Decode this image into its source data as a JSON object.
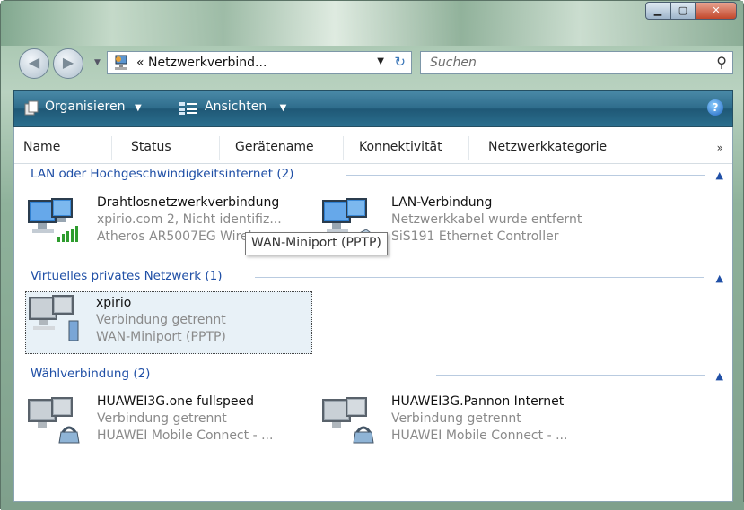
{
  "address": {
    "path": "« Netzwerkverbind..."
  },
  "search": {
    "placeholder": "Suchen"
  },
  "toolbar": {
    "organize_label": "Organisieren",
    "views_label": "Ansichten"
  },
  "columns": [
    "Name",
    "Status",
    "Gerätename",
    "Konnektivität",
    "Netzwerkkategorie"
  ],
  "groups": [
    {
      "title": "LAN oder Hochgeschwindigkeitsinternet (2)",
      "items": [
        {
          "name": "Drahtlosnetzwerkverbindung",
          "status": "xpirio.com  2, Nicht identifiz...",
          "device": "Atheros AR5007EG Wireless ...",
          "icon": "wireless-network-icon"
        },
        {
          "name": "LAN-Verbindung",
          "status": "Netzwerkkabel wurde entfernt",
          "device": "SiS191 Ethernet Controller",
          "icon": "lan-disconnected-icon"
        }
      ]
    },
    {
      "title": "Virtuelles privates Netzwerk (1)",
      "items": [
        {
          "name": "xpirio",
          "status": "Verbindung getrennt",
          "device": "WAN-Miniport (PPTP)",
          "icon": "vpn-icon"
        }
      ]
    },
    {
      "title": "Wählverbindung (2)",
      "items": [
        {
          "name": "HUAWEI3G.one fullspeed",
          "status": "Verbindung getrennt",
          "device": "HUAWEI Mobile Connect - ...",
          "icon": "dialup-modem-icon"
        },
        {
          "name": "HUAWEI3G.Pannon Internet",
          "status": "Verbindung getrennt",
          "device": "HUAWEI Mobile Connect - ...",
          "icon": "dialup-modem-icon"
        }
      ]
    }
  ],
  "tooltip": "WAN-Miniport (PPTP)"
}
